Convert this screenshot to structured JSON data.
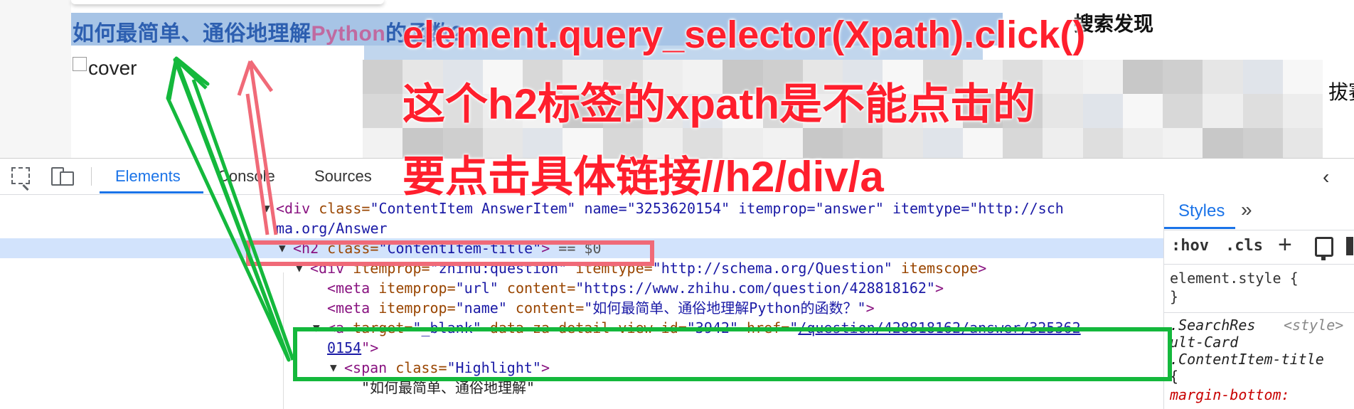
{
  "webpage": {
    "title_part1": "如何最简单、通俗地理解",
    "title_part2": "Python",
    "title_part3": "的函数?",
    "cover_alt": "cover",
    "side_title": "搜索发现",
    "side_text": "拔赛"
  },
  "annotations": {
    "line1": "element.query_selector(Xpath).click()",
    "line2": "这个h2标签的xpath是不能点击的",
    "line3": "要点击具体链接//h2/div/a",
    "red_color": "#ff1f2d",
    "pink_color": "#f06a78",
    "green_color": "#14b83c"
  },
  "devtools": {
    "tabs": [
      "Elements",
      "Console",
      "Sources"
    ],
    "active_tab": "Elements",
    "collapse_glyph": "‹",
    "gutter_dots": "…",
    "dom": {
      "l1": {
        "tri": "▼",
        "open": "<",
        "tag": "div",
        "attr": " class=",
        "val": "\"ContentItem AnswerItem\"",
        "rest": " name=\"3253620154\" itemprop=\"answer\" itemtype=\"http://sch"
      },
      "l2": {
        "text": "ma.org/Answer"
      },
      "l3": {
        "tri": "▼",
        "open": "<",
        "tag": "h2",
        "attr": " class=",
        "val": "\"ContentItem-title\"",
        "close": ">",
        "eq": " == $0"
      },
      "l4": {
        "tri": "▼",
        "open": "<",
        "tag": "div",
        "a1": " itemprop=",
        "v1": "\"zhihu:question\"",
        "a2": " itemtype=",
        "v2": "\"http://schema.org/Question\"",
        "a3": " itemscope",
        "close": ">"
      },
      "l5": {
        "open": "<",
        "tag": "meta",
        "a1": " itemprop=",
        "v1": "\"url\"",
        "a2": " content=",
        "v2": "\"https://www.zhihu.com/question/428818162\"",
        "close": ">"
      },
      "l6": {
        "open": "<",
        "tag": "meta",
        "a1": " itemprop=",
        "v1": "\"name\"",
        "a2": " content=",
        "v2": "\"如何最简单、通俗地理解Python的函数？\"",
        "close": ">"
      },
      "l7": {
        "tri": "▼",
        "open": "<",
        "tag": "a",
        "a1": " target=",
        "v1": "\"_blank\"",
        "a2": " data-za-detail-view-id=",
        "v2": "\"3942\"",
        "a3": " href=",
        "v3q": "\"",
        "link": "/question/428818162/answer/325362"
      },
      "l8": {
        "link": "0154",
        "close": "\">"
      },
      "l9": {
        "tri": "▼",
        "open": "<",
        "tag": "span",
        "attr": " class=",
        "val": "\"Highlight\"",
        "close": ">"
      },
      "l10": {
        "text": "\"如何最简单、通俗地理解\""
      }
    },
    "styles": {
      "tab": "Styles",
      "more": "»",
      "hov": ":hov",
      "cls": ".cls",
      "plus": "+",
      "element_style": "element.style {",
      "close_brace": "}",
      "sel1": ".SearchRes",
      "source": "<style>",
      "sel2": "ult-Card",
      "sel3": ".ContentItem-title",
      "open_brace": "{",
      "prop1": "margin-bottom:"
    }
  }
}
